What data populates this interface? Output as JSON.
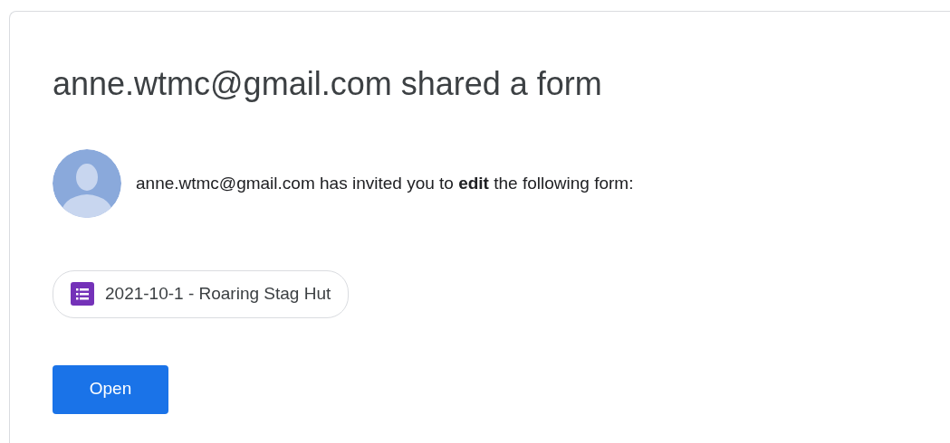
{
  "title": "anne.wtmc@gmail.com shared a form",
  "message": "anne.wtmc@gmail.com has invited you to **edit** the following form:",
  "file_chip": {
    "label": "2021-10-1 - Roaring Stag Hut"
  },
  "buttons": [
    "Open"
  ]
}
